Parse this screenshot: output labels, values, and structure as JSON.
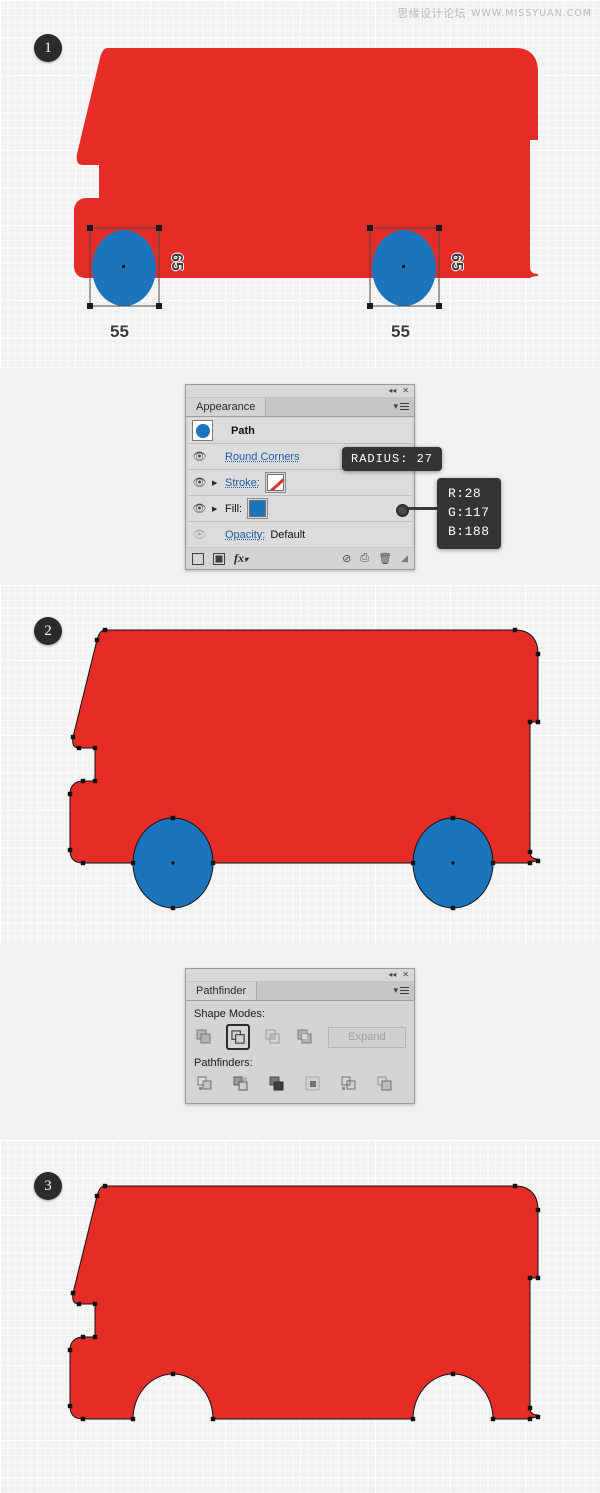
{
  "watermark": {
    "cn": "思缘设计论坛",
    "en": "WWW.MISSYUAN.COM"
  },
  "steps": [
    {
      "number": "1"
    },
    {
      "number": "2"
    },
    {
      "number": "3"
    }
  ],
  "colors": {
    "bus_red": "#e42d27",
    "wheel_blue": "#1c75bc",
    "canvas": "#f2f2f2",
    "panel_bg": "#d4d4d4",
    "tooltip_bg": "#343434",
    "link_blue": "#1b5fa8"
  },
  "measurements": {
    "front_wheel_width": "55",
    "front_wheel_height": "65",
    "rear_wheel_width": "55",
    "rear_wheel_height": "65"
  },
  "appearance_panel": {
    "tab_label": "Appearance",
    "collapse_icon": "collapse-arrows-icon",
    "close_icon": "close-icon",
    "menu_icon": "panel-menu-icon",
    "rows": [
      {
        "eye": false,
        "arrow": false,
        "label": "Path",
        "kind": "object",
        "swatch": "blue-circle"
      },
      {
        "eye": true,
        "arrow": false,
        "label": "Round Corners",
        "kind": "effect"
      },
      {
        "eye": true,
        "arrow": true,
        "label": "Stroke:",
        "kind": "stroke",
        "swatch": "none-diagonal"
      },
      {
        "eye": true,
        "arrow": true,
        "label": "Fill:",
        "kind": "fill",
        "swatch": "blue"
      },
      {
        "eye": false,
        "arrow": false,
        "label": "Opacity:",
        "value": "Default",
        "kind": "opacity"
      }
    ],
    "footer_icons": [
      "add-new-stroke-icon",
      "add-new-fill-icon",
      "add-new-effect-icon",
      "clear-appearance-icon",
      "duplicate-item-icon",
      "delete-item-icon",
      "resize-grip-icon"
    ],
    "tooltip_radius": "RADIUS: 27",
    "tooltip_rgb": {
      "r": "R:28",
      "g": "G:117",
      "b": "B:188"
    }
  },
  "pathfinder_panel": {
    "tab_label": "Pathfinder",
    "collapse_icon": "collapse-arrows-icon",
    "close_icon": "close-icon",
    "menu_icon": "panel-menu-icon",
    "shape_modes_label": "Shape Modes:",
    "pathfinders_label": "Pathfinders:",
    "expand_label": "Expand",
    "shape_modes": [
      {
        "name": "unite-icon",
        "selected": false
      },
      {
        "name": "minus-front-icon",
        "selected": true
      },
      {
        "name": "intersect-icon",
        "selected": false
      },
      {
        "name": "exclude-icon",
        "selected": false
      }
    ],
    "pathfinders": [
      {
        "name": "divide-icon"
      },
      {
        "name": "trim-icon"
      },
      {
        "name": "merge-icon"
      },
      {
        "name": "crop-icon"
      },
      {
        "name": "outline-icon"
      },
      {
        "name": "minus-back-icon"
      }
    ]
  },
  "artwork": {
    "step1_caption_hidden": "",
    "step1": {
      "body_fill": "#e42d27",
      "wheels": 2,
      "wheel_fill": "#1c75bc",
      "selection_boxes": 2
    },
    "step2": {
      "body_fill": "#e42d27",
      "wheels": 2,
      "wheel_fill": "#1c75bc",
      "anchors_visible": true
    },
    "step3": {
      "body_fill": "#e42d27",
      "wheels": 0,
      "wheel_cutouts": 2,
      "anchors_visible": true
    }
  }
}
